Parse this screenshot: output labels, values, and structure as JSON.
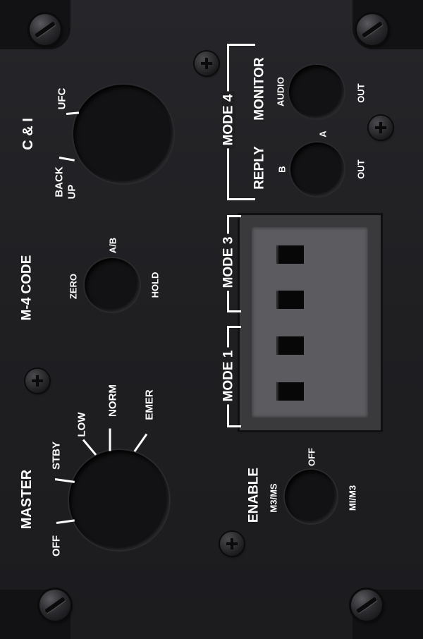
{
  "panel": {
    "master_section": {
      "title": "MASTER",
      "positions": [
        "OFF",
        "STBY",
        "LOW",
        "NORM",
        "EMER"
      ]
    },
    "m4_code_section": {
      "title": "M-4 CODE",
      "positions": [
        "ZERO",
        "A/B",
        "HOLD"
      ]
    },
    "c_and_i_section": {
      "title": "C & I",
      "positions": [
        "UFC",
        "BACK",
        "UP"
      ]
    },
    "mode4_section": {
      "title": "MODE 4",
      "monitor": {
        "title": "MONITOR",
        "left_label": "AUDIO",
        "right_label": "OUT"
      },
      "reply": {
        "title": "REPLY",
        "left_label": "B",
        "top_label": "A",
        "right_label": "OUT"
      }
    },
    "mode_switches": {
      "mode1_label": "MODE 1",
      "mode3_label": "MODE 3"
    },
    "enable_section": {
      "title": "ENABLE",
      "positions": [
        "M3/MS",
        "OFF",
        "MI/M3"
      ]
    }
  }
}
